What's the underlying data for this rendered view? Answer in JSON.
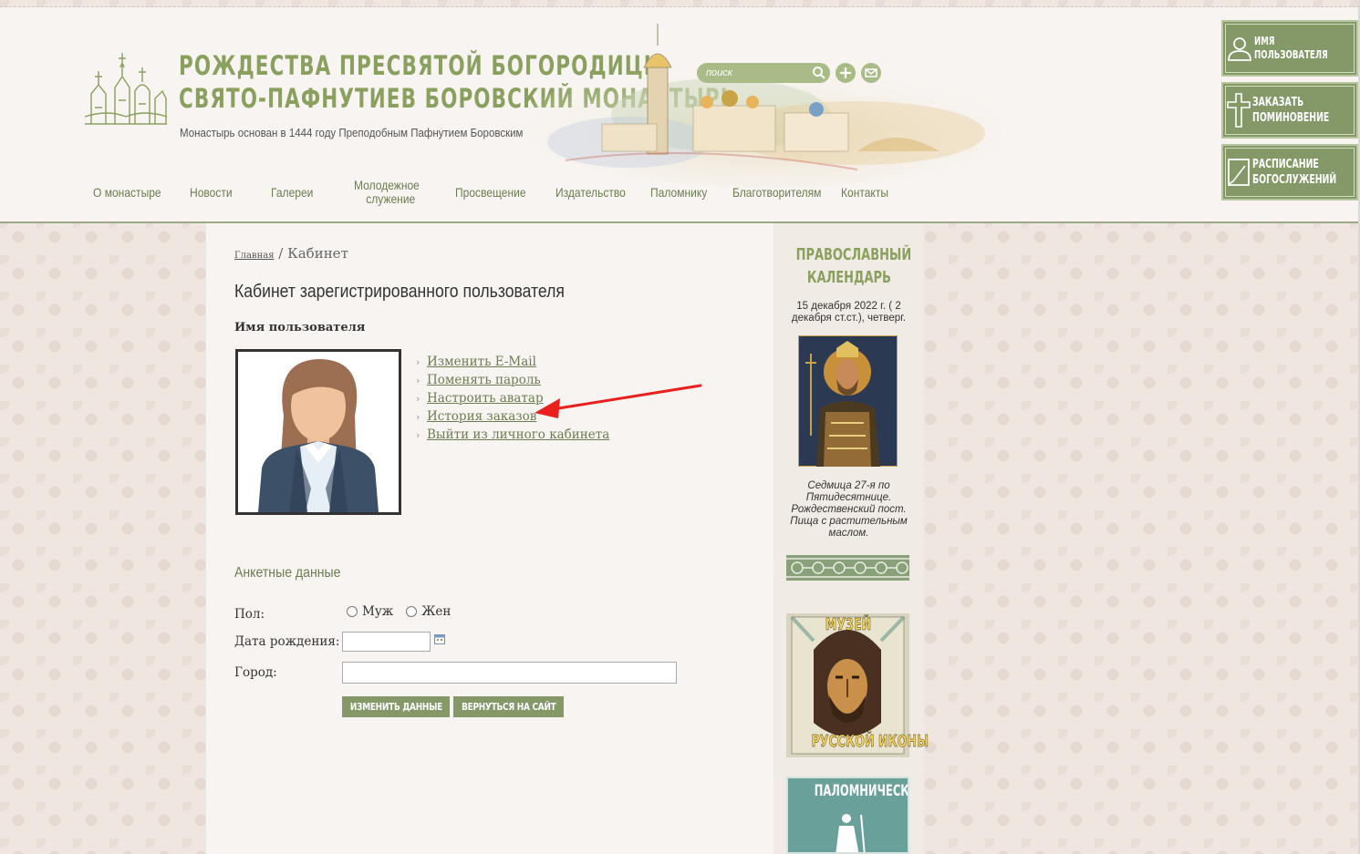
{
  "header": {
    "title_line1": "Рождества Пресвятой Богородицы",
    "title_line2": "Свято-Пафнутиев Боровский монастырь",
    "subtitle": "Монастырь основан в 1444 году Преподобным Пафнутием Боровским",
    "search_placeholder": "поиск"
  },
  "nav": [
    {
      "label": "О монастыре"
    },
    {
      "label": "Новости"
    },
    {
      "label": "Галереи"
    },
    {
      "label_line1": "Молодежное",
      "label_line2": "служение"
    },
    {
      "label": "Просвещение"
    },
    {
      "label": "Издательство"
    },
    {
      "label": "Паломнику"
    },
    {
      "label": "Благотворителям"
    },
    {
      "label": "Контакты"
    }
  ],
  "side_buttons": [
    {
      "line1": "Имя",
      "line2": "пользователя",
      "icon": "user-icon"
    },
    {
      "line1": "Заказать",
      "line2": "поминовение",
      "icon": "cross-icon"
    },
    {
      "line1": "Расписание",
      "line2": "богослужений",
      "icon": "book-icon"
    }
  ],
  "breadcrumb": {
    "home": "Главная",
    "separator": " / ",
    "current": "Кабинет"
  },
  "page_title": "Кабинет зарегистрированного пользователя",
  "user_name": "Имя пользователя",
  "account_links": [
    {
      "label": "Изменить E-Mail"
    },
    {
      "label": "Поменять пароль"
    },
    {
      "label": "Настроить аватар"
    },
    {
      "label": "История заказов"
    },
    {
      "label": "Выйти из личного кабинета"
    }
  ],
  "profile": {
    "section_title": "Анкетные данные",
    "gender_label": "Пол:",
    "gender_options": [
      "Муж",
      "Жен"
    ],
    "birthdate_label": "Дата рождения:",
    "birthdate_value": "",
    "city_label": "Город:",
    "city_value": "",
    "save_button": "Изменить данные",
    "back_button": "Вернуться на сайт"
  },
  "calendar": {
    "title_line1": "Православный",
    "title_line2": "календарь",
    "date_text": "15 декабря 2022 г. ( 2 декабря ст.ст.), четверг.",
    "note": "Седмица 27-я по Пятидесятнице. Рождественский пост. Пища с растительным маслом."
  },
  "museum_banner": {
    "line1": "Музей",
    "line2": "русской иконы"
  },
  "pilgrim_banner": {
    "line1": "Паломническая"
  },
  "colors": {
    "accent": "#849868",
    "title_green": "#8aa05e",
    "link_green": "#6b7d52",
    "arrow": "#e8201e"
  }
}
